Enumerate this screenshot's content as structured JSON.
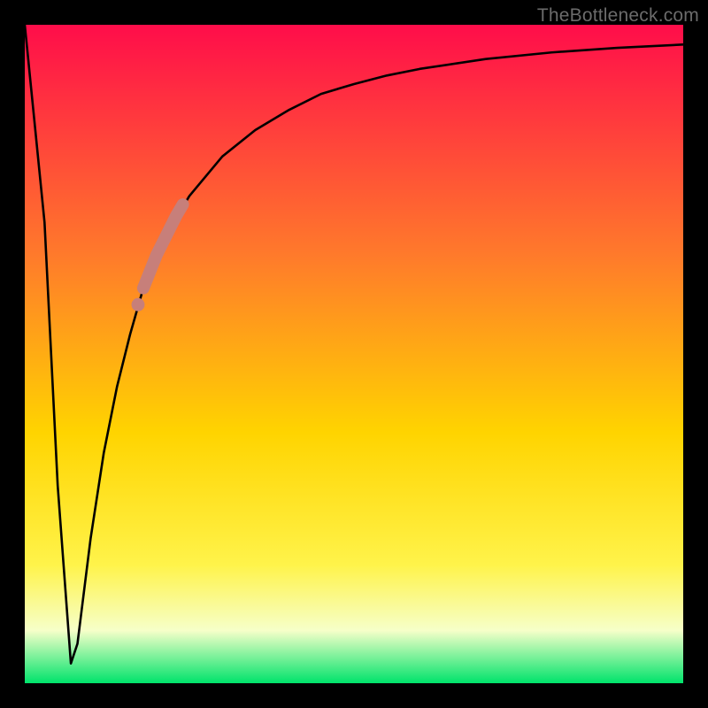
{
  "credit": "TheBottleneck.com",
  "colors": {
    "top": "#ff0d4a",
    "mid_upper": "#ff7a2b",
    "mid": "#ffd400",
    "mid_lower": "#fff34a",
    "pale": "#f6ffc9",
    "bottom": "#00e36b",
    "curve": "#000000",
    "highlight": "#c77f7a"
  },
  "chart_data": {
    "type": "line",
    "title": "",
    "xlabel": "",
    "ylabel": "",
    "xlim": [
      0,
      100
    ],
    "ylim": [
      0,
      100
    ],
    "grid": false,
    "legend": false,
    "series": [
      {
        "name": "bottleneck-curve",
        "x": [
          0,
          3,
          5,
          7,
          8,
          10,
          12,
          14,
          16,
          18,
          20,
          22,
          25,
          30,
          35,
          40,
          45,
          50,
          55,
          60,
          70,
          80,
          90,
          100
        ],
        "y": [
          100,
          70,
          30,
          3,
          6,
          22,
          35,
          45,
          53,
          60,
          65,
          69,
          74,
          80,
          84,
          87,
          89.5,
          91,
          92.3,
          93.3,
          94.8,
          95.8,
          96.5,
          97
        ]
      }
    ],
    "annotations": [
      {
        "name": "highlight-segment",
        "type": "thick-stroke",
        "x": [
          18,
          19,
          20,
          21,
          22,
          23,
          24
        ],
        "y": [
          60,
          62.5,
          65,
          67,
          69,
          71,
          72.7
        ]
      },
      {
        "name": "highlight-dot",
        "type": "dot",
        "x": 17.2,
        "y": 57.5
      }
    ]
  }
}
